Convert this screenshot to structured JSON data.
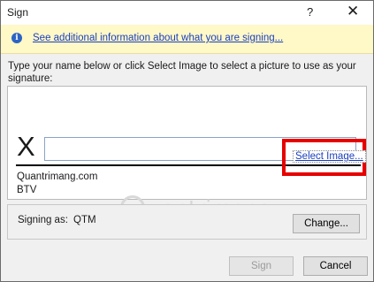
{
  "window": {
    "title": "Sign",
    "help_glyph": "?",
    "close_glyph": "✕"
  },
  "info_bar": {
    "icon": "info-icon",
    "icon_glyph": "i",
    "link_text": "See additional information about what you are signing..."
  },
  "instructions": "Type your name below or click Select Image to select a picture to use as your signature:",
  "signature": {
    "x_mark": "X",
    "name_input_value": "",
    "select_image_label": "Select Image...",
    "signer_name": "Quantrimang.com",
    "signer_title": "BTV",
    "highlight_color": "#e60000"
  },
  "signing_as": {
    "label": "Signing as:",
    "value": "QTM",
    "change_label": "Change..."
  },
  "watermark": "uantrimang",
  "buttons": {
    "sign_label": "Sign",
    "cancel_label": "Cancel"
  }
}
